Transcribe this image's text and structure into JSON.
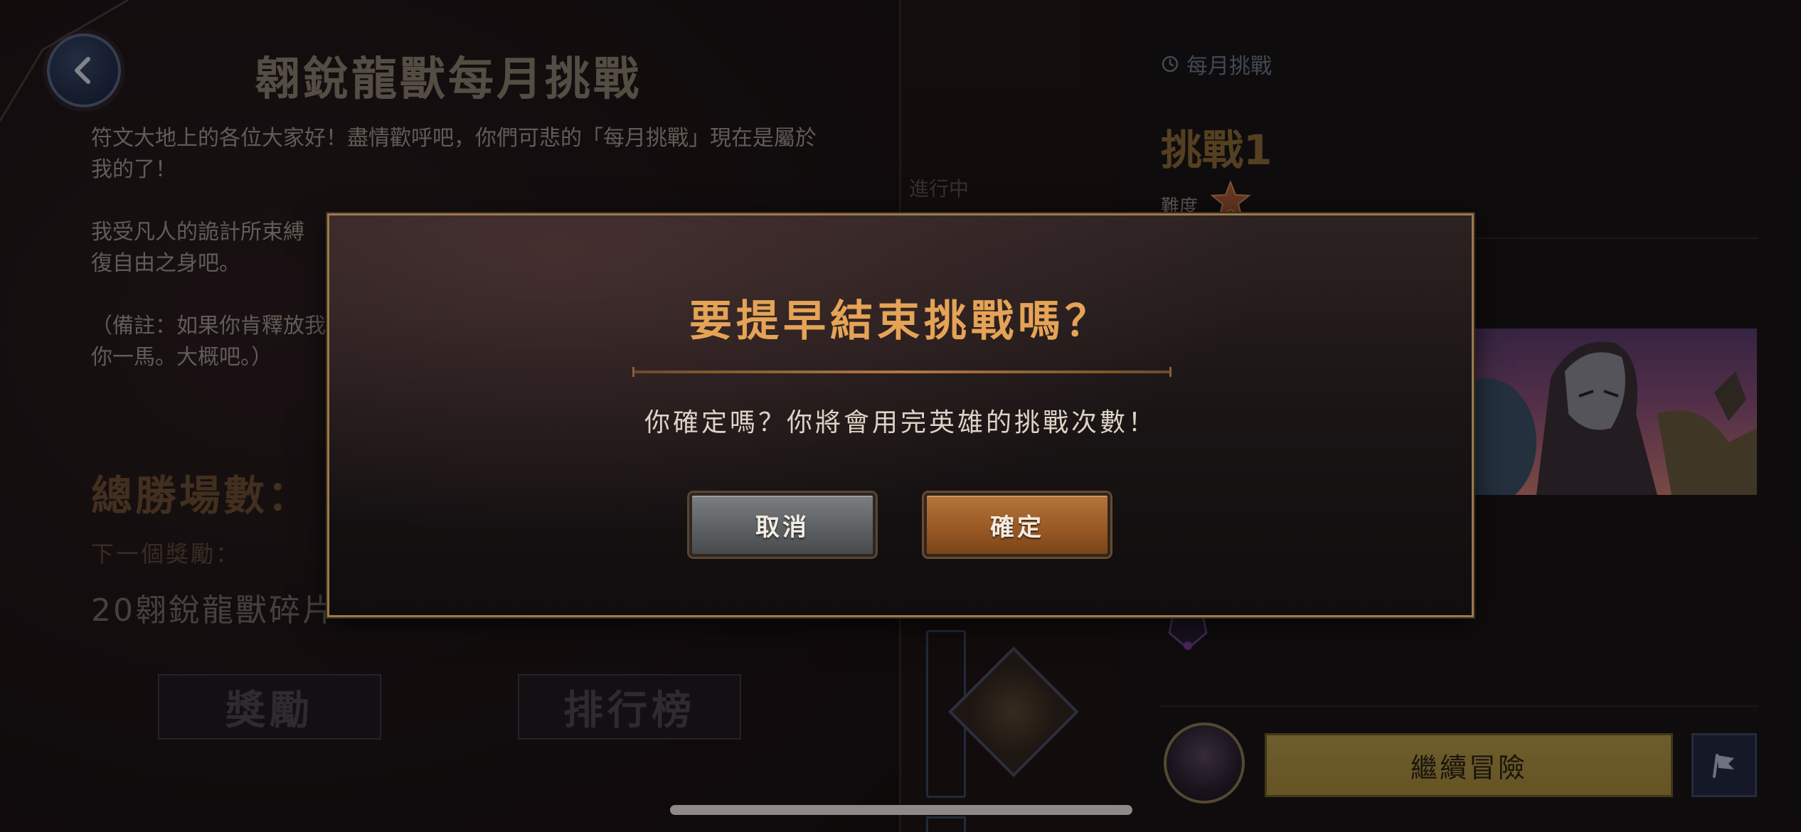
{
  "left_panel": {
    "title": "翱銳龍獸每月挑戰",
    "description": [
      "符文大地上的各位大家好！盡情歡呼吧，你們可悲的「每月挑戰」現在是屬於我的了！",
      "我受凡人的詭計所束縛",
      "復自由之身吧。",
      "（備註：如果你肯釋放我",
      "你一馬。大概吧。）"
    ],
    "total_wins_label": "總勝場數：",
    "next_reward_label": "下一個獎勵：",
    "next_reward_value": "20翱銳龍獸碎片",
    "rewards_button": "獎勵",
    "leaderboard_button": "排行榜"
  },
  "middle": {
    "status": "進行中"
  },
  "right_panel": {
    "monthly_label": "每月挑戰",
    "challenge_title": "挑戰1",
    "difficulty_label": "難度",
    "continue_button": "繼續冒險"
  },
  "modal": {
    "title": "要提早結束挑戰嗎？",
    "message": "你確定嗎？你將會用完英雄的挑戰次數！",
    "cancel_button": "取消",
    "confirm_button": "確定"
  },
  "icons": {
    "back": "back-arrow-icon",
    "clock": "clock-icon",
    "star": "star-icon",
    "flag": "flag-icon"
  },
  "colors": {
    "modal_title": "#e5a356",
    "accent_gold": "#b69a4a",
    "confirm": "#9a5a25",
    "cancel": "#5d6163"
  }
}
